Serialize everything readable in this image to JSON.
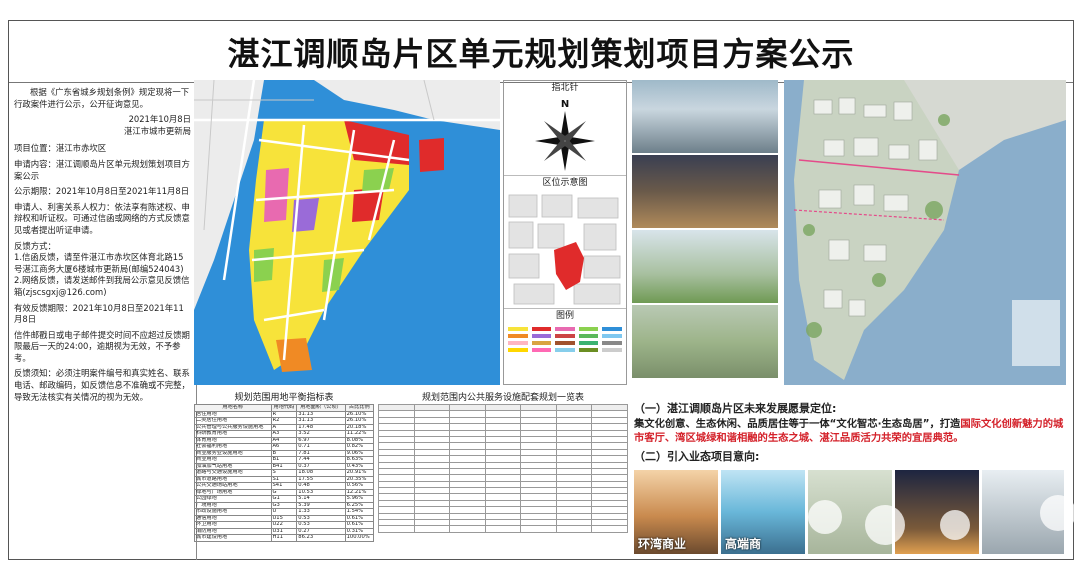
{
  "title": "湛江调顺岛片区单元规划策划项目方案公示",
  "notice": {
    "intro": "根据《广东省城乡规划条例》规定现将一下行政案件进行公示，公开征询意见。",
    "date": "2021年10月8日",
    "issuer": "湛江市城市更新局",
    "location": "项目位置：湛江市赤坎区",
    "applicant": "申请内容：湛江调顺岛片区单元规划策划项目方案公示",
    "period": "公示期限：2021年10月8日至2021年11月8日",
    "rights": "申请人、利害关系人权力：依法享有陈述权、申辩权和听证权。可通过信函或网络的方式反馈意见或者提出听证申请。",
    "feedback_title": "反馈方式：",
    "feedback_1": "1.信函反馈，请至件湛江市赤坎区体育北路15号湛江商务大厦6楼城市更新局(邮编524043)",
    "feedback_2": "2.网络反馈，请发送邮件到我局公示意见反馈信箱(zjscsgxj@126.com)",
    "valid_period": "有效反馈期限：2021年10月8日至2021年11月8日",
    "deadline": "信件邮戳日或电子邮件提交时间不应超过反馈期限最后一天的24:00，逾期视为无效，不予参考。",
    "notes": "反馈须知：必须注明案件编号和真实姓名、联系电话、邮政编码，如反馈信息不准确或不完整，导致无法核实有关情况的视为无效。"
  },
  "panels": {
    "north": "指北针",
    "north_letter": "N",
    "location_map": "区位示意图",
    "legend": "图例"
  },
  "table1": {
    "title": "规划范围用地平衡指标表",
    "headers": [
      "用地名称",
      "用地代码",
      "用地面积（公顷）",
      "占比比例"
    ],
    "rows": [
      [
        "居住用地",
        "R",
        "31.13",
        "26.10%"
      ],
      [
        "二类居住用地",
        "R2",
        "31.13",
        "26.10%"
      ],
      [
        "公共管理与公共服务设施用地",
        "A",
        "17.48",
        "20.18%"
      ],
      [
        "科研教育用地",
        "A3",
        "3.52",
        "11.22%"
      ],
      [
        "体育用地",
        "A4",
        "6.97",
        "8.08%"
      ],
      [
        "社会福利用地",
        "A6",
        "0.71",
        "0.82%"
      ],
      [
        "商业服务业设施用地",
        "B",
        "7.81",
        "9.06%"
      ],
      [
        "商业用地",
        "B1",
        "7.44",
        "8.63%"
      ],
      [
        "加油加气站用地",
        "B41",
        "0.37",
        "0.43%"
      ],
      [
        "道路与交通设施用地",
        "S",
        "18.08",
        "20.91%"
      ],
      [
        "城市道路用地",
        "S1",
        "17.55",
        "20.35%"
      ],
      [
        "公共交通场站用地",
        "S41",
        "0.48",
        "0.56%"
      ],
      [
        "绿地与广场用地",
        "G",
        "10.53",
        "12.21%"
      ],
      [
        "公园绿地",
        "G1",
        "5.14",
        "5.96%"
      ],
      [
        "广场用地",
        "G3",
        "5.39",
        "6.25%"
      ],
      [
        "市政设施用地",
        "U",
        "1.33",
        "1.54%"
      ],
      [
        "通信用地",
        "U15",
        "0.53",
        "0.61%"
      ],
      [
        "环卫用地",
        "U22",
        "0.53",
        "0.61%"
      ],
      [
        "消防用地",
        "U31",
        "0.27",
        "0.31%"
      ],
      [
        "城市建设用地",
        "H11",
        "86.23",
        "100.00%"
      ]
    ]
  },
  "table2": {
    "title": "规划范围内公共服务设施配套规划一览表"
  },
  "vision": {
    "heading": "（一）湛江调顺岛片区未来发展愿景定位:",
    "body_1": "集文化创意、生态休闲、品质居住等于一体“文化智芯·生态岛居”，打造",
    "body_red": "国际文化创新魅力的城市客厅、湾区城绿和谐相融的生态之城、湛江品质活力共荣的宜居典范。",
    "heading_2": "（二）引入业态项目意向:"
  },
  "biz_tiles": [
    {
      "caption": "环湾商业"
    },
    {
      "caption": "高端商"
    },
    {
      "caption": ""
    },
    {
      "caption": ""
    },
    {
      "caption": ""
    }
  ],
  "colors": {
    "residential": "#f7e33a",
    "commercial": "#e02b2b",
    "public": "#e86ab0",
    "green": "#8bd14f",
    "water": "#2f8fd8",
    "road": "#ffffff",
    "accent_red": "#d4212a"
  }
}
